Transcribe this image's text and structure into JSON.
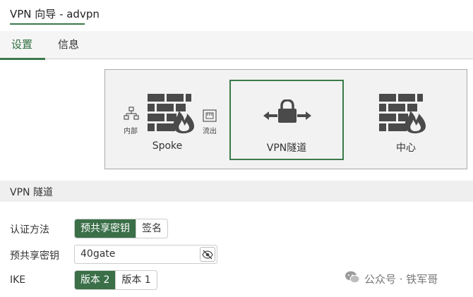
{
  "header": {
    "title": "VPN 向导 - advpn"
  },
  "tabs": [
    {
      "label": "设置",
      "active": true
    },
    {
      "label": "信息",
      "active": false
    }
  ],
  "topology": {
    "spoke": {
      "label": "Spoke",
      "internal_label": "内部",
      "outbound_label": "流出"
    },
    "tunnel": {
      "label": "VPN隧道"
    },
    "hub": {
      "label": "中心"
    }
  },
  "section": {
    "title": "VPN 隧道"
  },
  "form": {
    "auth_method": {
      "label": "认证方法",
      "options": [
        "预共享密钥",
        "签名"
      ],
      "selected": "预共享密钥"
    },
    "psk": {
      "label": "预共享密钥",
      "value": "40gate"
    },
    "ike": {
      "label": "IKE",
      "options": [
        "版本 2",
        "版本 1"
      ],
      "selected": "版本 2"
    }
  },
  "watermark": {
    "text": "公众号 · 铁军哥"
  },
  "colors": {
    "accent": "#3a7a4a",
    "icon_dark": "#4a4a4a"
  }
}
